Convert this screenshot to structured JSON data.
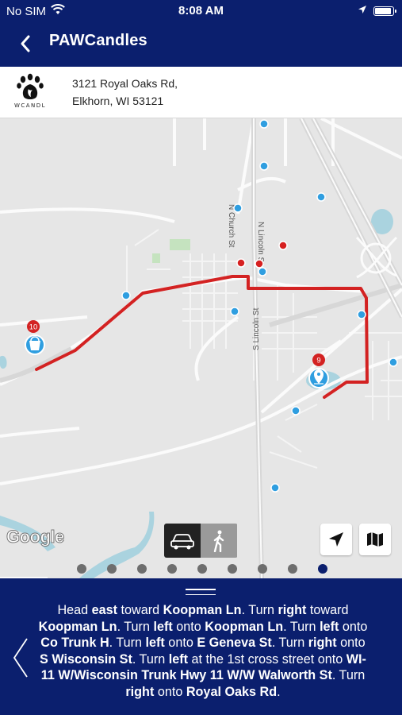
{
  "status_bar": {
    "carrier": "No SIM",
    "time": "8:08 AM",
    "battery_level": 1.0
  },
  "nav": {
    "title": "PAWCandles",
    "back_icon": "chevron-left-icon"
  },
  "address": {
    "logo_text": "WCANDL",
    "line1": "3121 Royal Oaks Rd,",
    "line2": "Elkhorn, WI 53121"
  },
  "map": {
    "streets": [
      "N Church St",
      "N Lincoln St",
      "S Lincoln St"
    ],
    "markers": [
      {
        "label": "10",
        "icon": "bucket-icon"
      },
      {
        "label": "9",
        "icon": "location-pin-icon"
      }
    ],
    "route_color": "#d32222",
    "poi_blue": "#2f9ee0",
    "poi_red": "#d62020",
    "attribution": "Google",
    "travel_modes": [
      {
        "name": "drive",
        "icon": "car-icon",
        "active": true
      },
      {
        "name": "walk",
        "icon": "walk-icon",
        "active": false
      }
    ],
    "controls": [
      "navigate-arrow-icon",
      "map-icon"
    ]
  },
  "pager": {
    "count": 9,
    "active_index": 8
  },
  "directions": {
    "segments": [
      {
        "t": "Head ",
        "b": false
      },
      {
        "t": "east",
        "b": true
      },
      {
        "t": " toward ",
        "b": false
      },
      {
        "t": "Koopman Ln",
        "b": true
      },
      {
        "t": ". Turn ",
        "b": false
      },
      {
        "t": "right",
        "b": true
      },
      {
        "t": " toward ",
        "b": false
      },
      {
        "t": "Koopman Ln",
        "b": true
      },
      {
        "t": ". Turn ",
        "b": false
      },
      {
        "t": "left",
        "b": true
      },
      {
        "t": " onto ",
        "b": false
      },
      {
        "t": "Koopman Ln",
        "b": true
      },
      {
        "t": ". Turn ",
        "b": false
      },
      {
        "t": "left",
        "b": true
      },
      {
        "t": " onto ",
        "b": false
      },
      {
        "t": "Co Trunk H",
        "b": true
      },
      {
        "t": ". Turn ",
        "b": false
      },
      {
        "t": "left",
        "b": true
      },
      {
        "t": " onto ",
        "b": false
      },
      {
        "t": "E Geneva St",
        "b": true
      },
      {
        "t": ". Turn ",
        "b": false
      },
      {
        "t": "right",
        "b": true
      },
      {
        "t": " onto ",
        "b": false
      },
      {
        "t": "S Wisconsin St",
        "b": true
      },
      {
        "t": ". Turn ",
        "b": false
      },
      {
        "t": "left",
        "b": true
      },
      {
        "t": " at the 1st cross street onto ",
        "b": false
      },
      {
        "t": "WI-11 W/Wisconsin Trunk Hwy 11 W/W Walworth St",
        "b": true
      },
      {
        "t": ". Turn ",
        "b": false
      },
      {
        "t": "right",
        "b": true
      },
      {
        "t": " onto ",
        "b": false
      },
      {
        "t": "Royal Oaks Rd",
        "b": true
      },
      {
        "t": ".",
        "b": false
      }
    ]
  }
}
